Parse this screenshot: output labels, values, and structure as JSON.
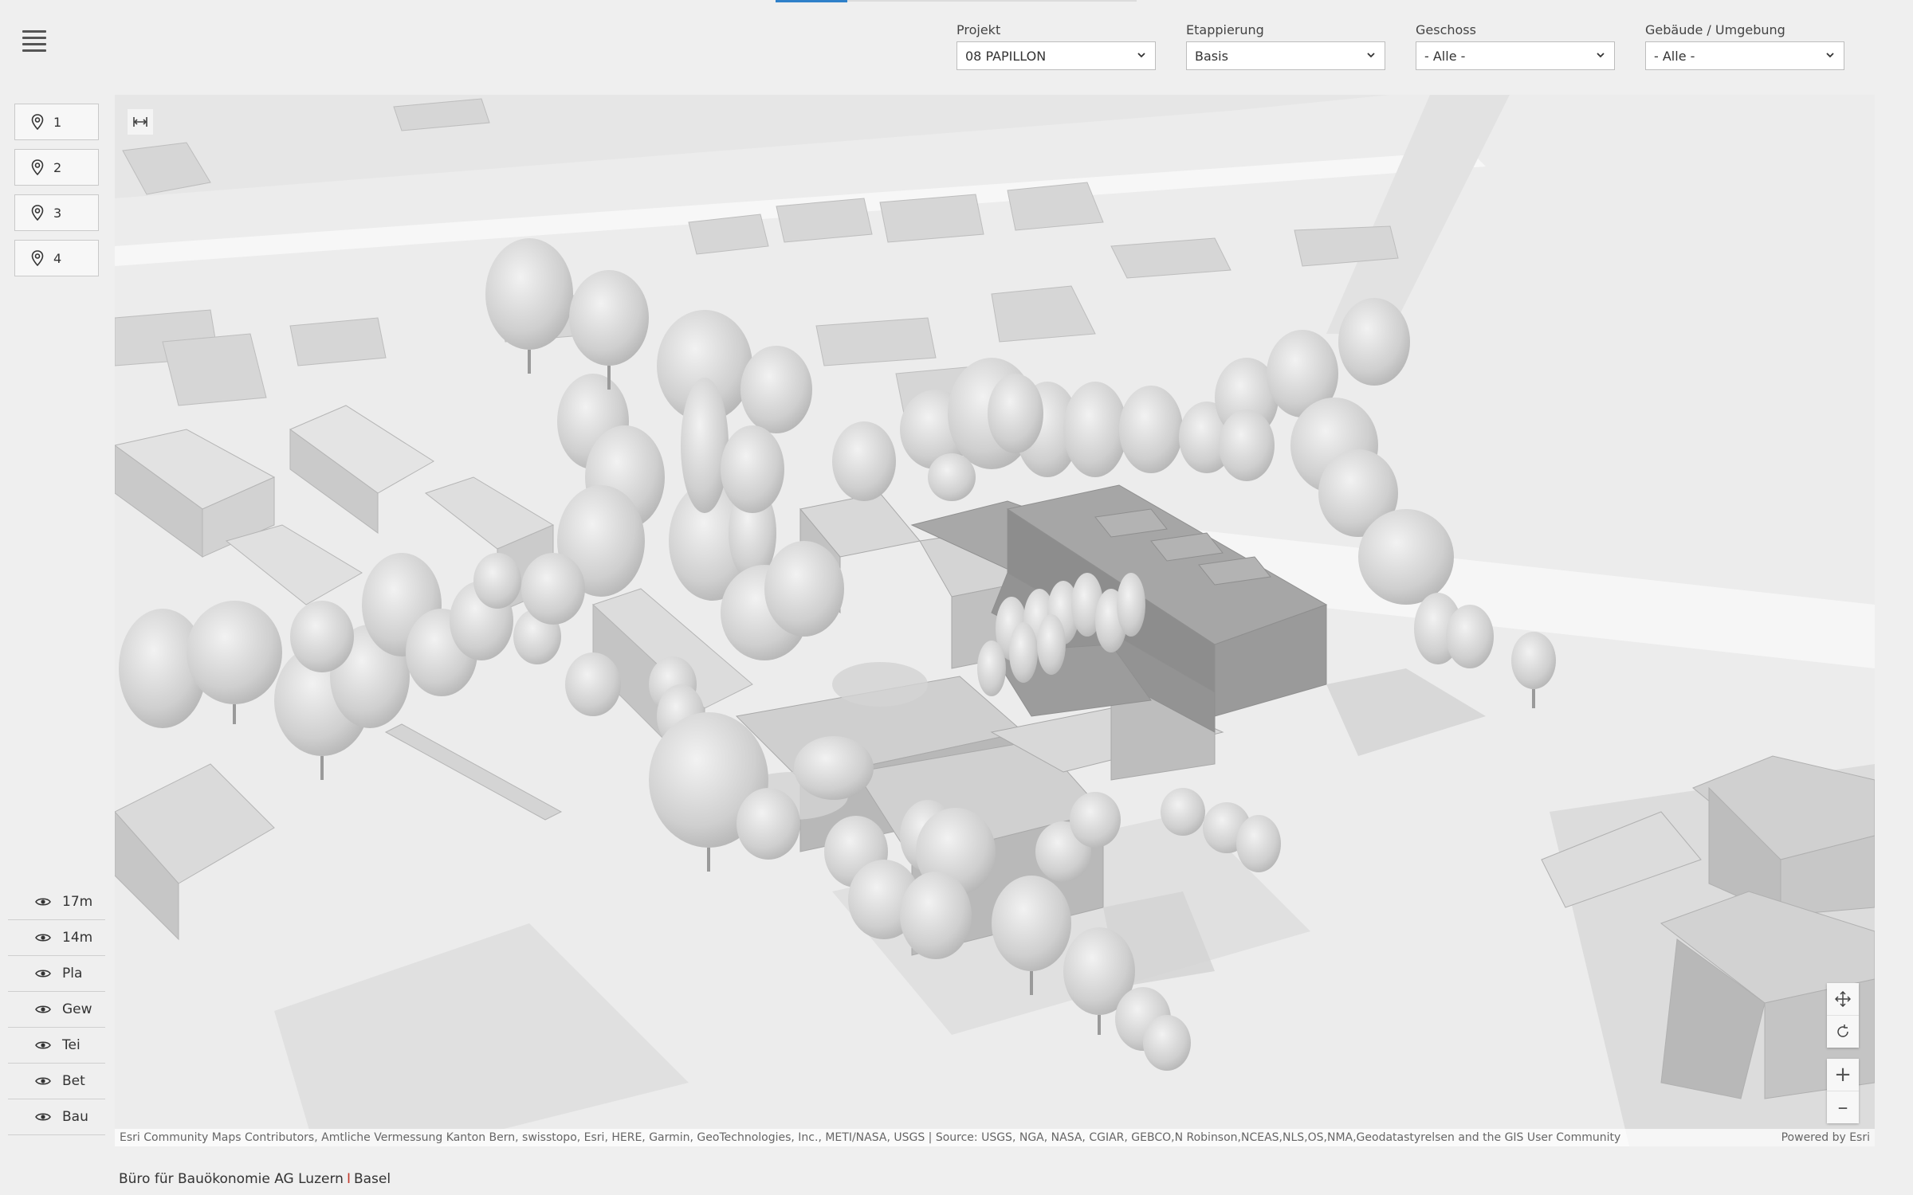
{
  "header": {
    "menu_icon": "hamburger-menu-icon",
    "filters": [
      {
        "label": "Projekt",
        "value": "08 PAPILLON"
      },
      {
        "label": "Etappierung",
        "value": "Basis"
      },
      {
        "label": "Geschoss",
        "value": "- Alle -"
      },
      {
        "label": "Gebäude / Umgebung",
        "value": "- Alle -"
      }
    ]
  },
  "bookmarks": [
    {
      "label": "1",
      "icon": "map-pin-icon"
    },
    {
      "label": "2",
      "icon": "map-pin-icon"
    },
    {
      "label": "3",
      "icon": "map-pin-icon"
    },
    {
      "label": "4",
      "icon": "map-pin-icon"
    }
  ],
  "layers": [
    {
      "label": "17m",
      "icon": "eye-icon"
    },
    {
      "label": "14m",
      "icon": "eye-icon"
    },
    {
      "label": "Pla",
      "icon": "eye-icon"
    },
    {
      "label": "Gew",
      "icon": "eye-icon"
    },
    {
      "label": "Tei",
      "icon": "eye-icon"
    },
    {
      "label": "Bet",
      "icon": "eye-icon"
    },
    {
      "label": "Bau",
      "icon": "eye-icon"
    }
  ],
  "map": {
    "attribution": "Esri Community Maps Contributors, Amtliche Vermessung Kanton Bern, swisstopo, Esri, HERE, Garmin, GeoTechnologies, Inc., METI/NASA, USGS | Source: USGS, NGA, NASA, CGIAR, GEBCO,N Robinson,NCEAS,NLS,OS,NMA,Geodatastyrelsen and the GIS User Community",
    "powered_by": "Powered by Esri",
    "controls": [
      "pan-icon",
      "rotate-icon",
      "zoom-in-icon",
      "zoom-out-icon"
    ],
    "zoom_in_label": "+",
    "zoom_out_label": "–"
  },
  "footer": {
    "company": "Büro für Bauökonomie AG Luzern",
    "separator": "I",
    "city": "Basel"
  }
}
